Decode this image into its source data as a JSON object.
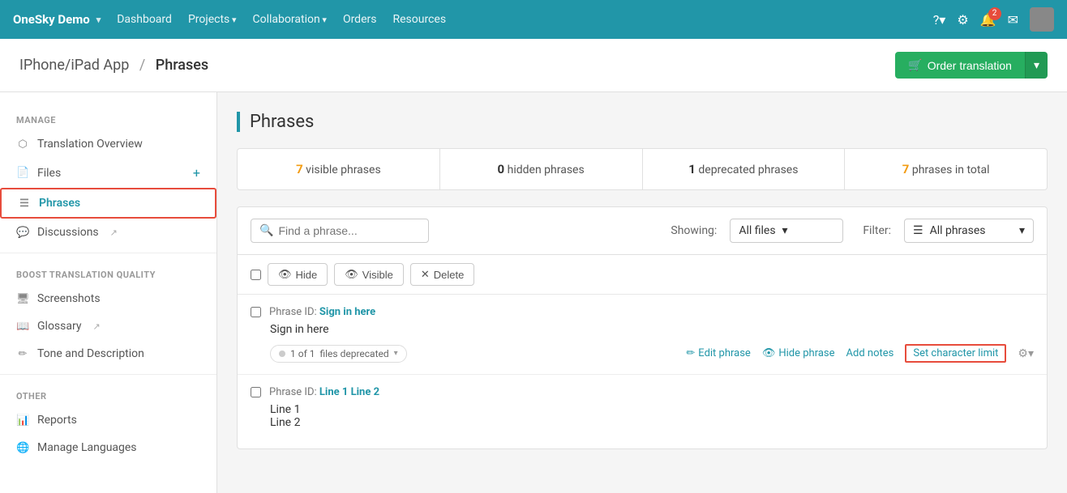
{
  "brand": {
    "name": "OneSky Demo",
    "chevron": "▾"
  },
  "nav": {
    "links": [
      {
        "label": "Dashboard",
        "has_arrow": false
      },
      {
        "label": "Projects",
        "has_arrow": true
      },
      {
        "label": "Collaboration",
        "has_arrow": true
      },
      {
        "label": "Orders",
        "has_arrow": false
      },
      {
        "label": "Resources",
        "has_arrow": false
      }
    ]
  },
  "breadcrumb": {
    "project": "IPhone/iPad App",
    "separator": "/",
    "current": "Phrases"
  },
  "order_translation_label": "Order translation",
  "sidebar": {
    "manage_label": "MANAGE",
    "items_manage": [
      {
        "label": "Translation Overview",
        "icon": "📊",
        "active": false,
        "key": "translation-overview"
      },
      {
        "label": "Files",
        "icon": "📄",
        "active": false,
        "key": "files",
        "has_plus": true
      },
      {
        "label": "Phrases",
        "icon": "☰",
        "active": true,
        "key": "phrases"
      }
    ],
    "discussions_label": "Discussions",
    "boost_label": "BOOST TRANSLATION QUALITY",
    "items_boost": [
      {
        "label": "Screenshots",
        "icon": "🖥",
        "key": "screenshots"
      },
      {
        "label": "Glossary",
        "icon": "📖",
        "key": "glossary",
        "ext": true
      },
      {
        "label": "Tone and Description",
        "icon": "✏",
        "key": "tone"
      }
    ],
    "other_label": "OTHER",
    "items_other": [
      {
        "label": "Reports",
        "icon": "📊",
        "key": "reports"
      },
      {
        "label": "Manage Languages",
        "icon": "🌐",
        "key": "manage-languages"
      }
    ]
  },
  "page_title": "Phrases",
  "stats": [
    {
      "num": "7",
      "label": "visible phrases",
      "color": "yellow"
    },
    {
      "num": "0",
      "label": "hidden phrases",
      "color": "normal"
    },
    {
      "num": "1",
      "label": "deprecated phrases",
      "color": "normal"
    },
    {
      "num": "7",
      "label": "phrases in total",
      "color": "yellow"
    }
  ],
  "search": {
    "placeholder": "Find a phrase..."
  },
  "showing_label": "Showing:",
  "all_files_label": "All files",
  "filter_label": "Filter:",
  "all_phrases_label": "All phrases",
  "toolbar": {
    "hide_label": "Hide",
    "visible_label": "Visible",
    "delete_label": "Delete"
  },
  "phrases": [
    {
      "id": "Phrase ID:",
      "key": "Sign in here",
      "text": "Sign in here",
      "files_info": "1 of 1",
      "files_suffix": "files deprecated",
      "deprecated": true,
      "actions": {
        "edit": "Edit phrase",
        "hide": "Hide phrase",
        "notes": "Add notes",
        "char_limit": "Set character limit"
      }
    },
    {
      "id": "Phrase ID:",
      "key": "Line 1 Line 2",
      "text_lines": [
        "Line 1",
        "Line 2"
      ],
      "files_info": "",
      "deprecated": false,
      "actions": {}
    }
  ]
}
